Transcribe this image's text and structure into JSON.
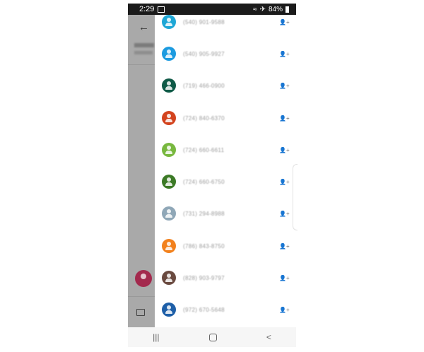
{
  "status_bar": {
    "time": "2:29",
    "battery": "84%"
  },
  "background_panel": {
    "back_icon": "arrow-left-icon",
    "title": "",
    "subtitle": ""
  },
  "contacts": [
    {
      "number": "(540) 901-9588",
      "color": "#1ea7d6"
    },
    {
      "number": "(540) 905-9927",
      "color": "#1c9be0"
    },
    {
      "number": "(719) 466-0900",
      "color": "#0f5a47"
    },
    {
      "number": "(724) 840-6370",
      "color": "#d3431e"
    },
    {
      "number": "(724) 660-6611",
      "color": "#78b83f"
    },
    {
      "number": "(724) 660-6750",
      "color": "#3c7a26"
    },
    {
      "number": "(731) 294-8988",
      "color": "#8fa7b7"
    },
    {
      "number": "(786) 843-8750",
      "color": "#f2811d"
    },
    {
      "number": "(828) 903-9797",
      "color": "#6a4a40"
    },
    {
      "number": "(972) 670-5648",
      "color": "#1e5fa8"
    }
  ],
  "add_contact_icon": "add-person-icon",
  "nav": {
    "recents": "|||",
    "home": "home",
    "back": "<"
  }
}
